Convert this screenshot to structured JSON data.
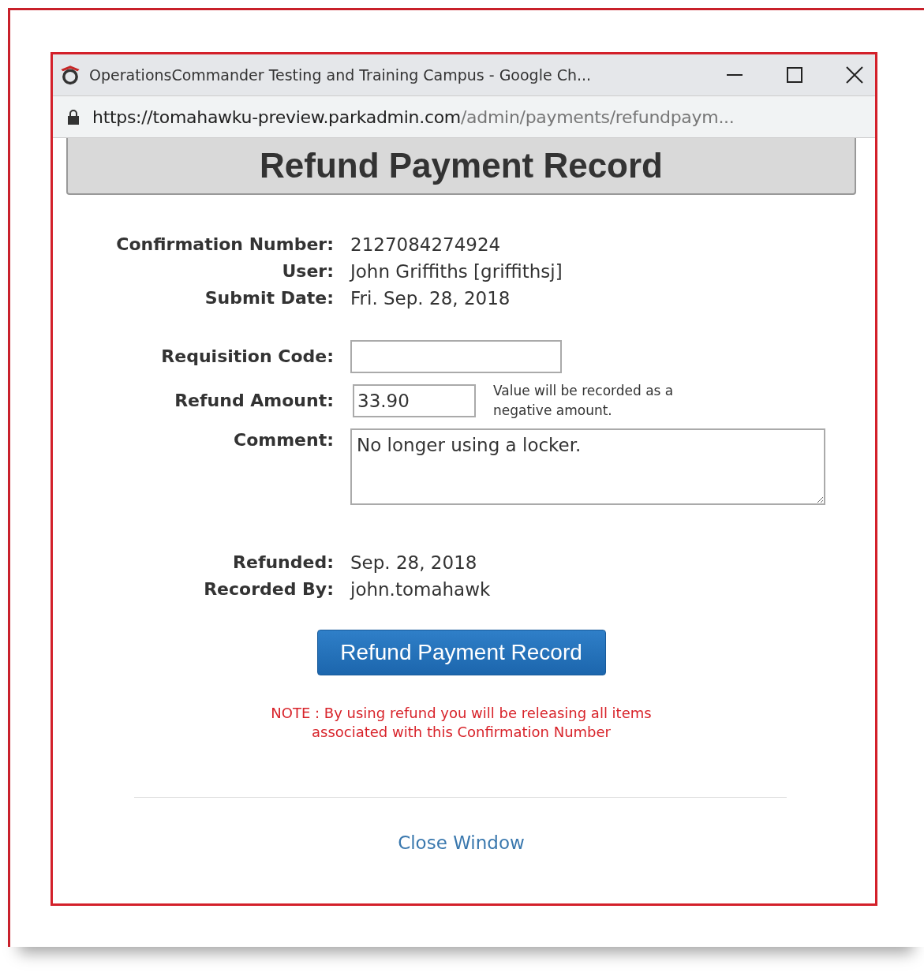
{
  "window": {
    "title": "OperationsCommander Testing and Training Campus - Google Ch..."
  },
  "address_bar": {
    "host": "https://tomahawku-preview.parkadmin.com",
    "path": "/admin/payments/refundpaym..."
  },
  "heading": "Refund Payment Record",
  "details": [
    {
      "label": "Confirmation Number:",
      "value": "2127084274924"
    },
    {
      "label": "User:",
      "value": "John Griffiths [griffithsj]"
    },
    {
      "label": "Submit Date:",
      "value": "Fri. Sep. 28, 2018"
    }
  ],
  "form": {
    "requisition_code": {
      "label": "Requisition Code:"
    },
    "refund_amount": {
      "label": "Refund Amount:",
      "value": "33.90",
      "hint": "Value will be recorded as a negative amount."
    },
    "comment": {
      "label": "Comment:",
      "value": "No longer using a locker."
    }
  },
  "record": [
    {
      "label": "Refunded:",
      "value": "Sep. 28, 2018"
    },
    {
      "label": "Recorded By:",
      "value": "john.tomahawk"
    }
  ],
  "submit_button": "Refund Payment Record",
  "note": "NOTE : By using refund you will be releasing all items associated with this Confirmation Number",
  "close_link": "Close Window"
}
